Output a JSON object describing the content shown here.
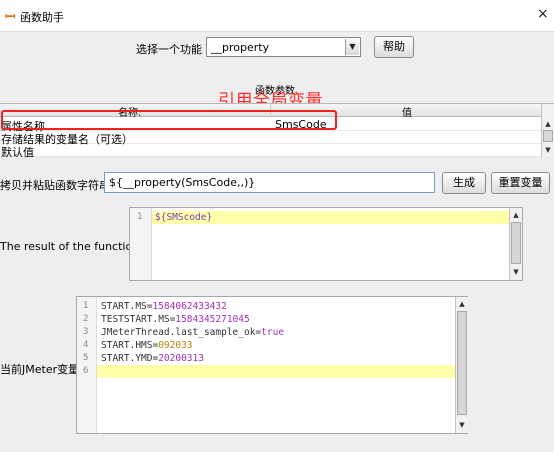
{
  "window": {
    "title": "函数助手",
    "close": "×"
  },
  "selector": {
    "label": "选择一个功能",
    "value": "__property",
    "help": "帮助"
  },
  "params": {
    "group_label": "函数参数",
    "annotation": "引用全局变量",
    "col_name": "名称:",
    "col_value": "值",
    "rows": [
      {
        "name": "属性名称",
        "value": "SmsCode"
      },
      {
        "name": "存储结果的变量名（可选）",
        "value": ""
      },
      {
        "name": "默认值",
        "value": ""
      }
    ]
  },
  "copy": {
    "label": "拷贝并粘贴函数字符串",
    "value": "${__property(SmsCode,,)}",
    "generate": "生成",
    "reset": "重置变量"
  },
  "result": {
    "label": "The result of the function is",
    "lines": [
      {
        "n": "1",
        "text": "${SMScode}"
      }
    ]
  },
  "vars": {
    "label": "当前JMeter变量",
    "lines": [
      {
        "n": "1",
        "key": "START.MS=",
        "val": "1584062433432"
      },
      {
        "n": "2",
        "key": "TESTSTART.MS=",
        "val": "1584345271045"
      },
      {
        "n": "3",
        "key": "JMeterThread.last_sample_ok=",
        "val": "true"
      },
      {
        "n": "4",
        "key": "START.HMS=",
        "val": "092033"
      },
      {
        "n": "5",
        "key": "START.YMD=",
        "val": "20200313"
      },
      {
        "n": "6",
        "key": "",
        "val": ""
      }
    ]
  },
  "colors": {
    "annotation": "#ff2a2a",
    "highlight": "#ffffaa",
    "number": "#a030c0"
  }
}
